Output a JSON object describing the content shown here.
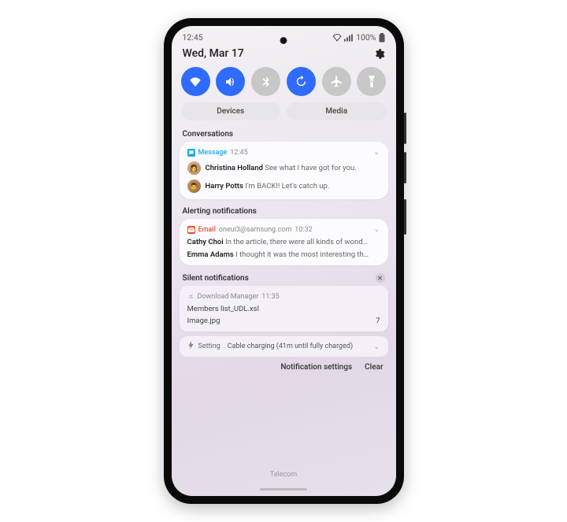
{
  "status": {
    "time": "12:45",
    "battery": "100%"
  },
  "header": {
    "date": "Wed, Mar 17"
  },
  "pills": {
    "devices": "Devices",
    "media": "Media"
  },
  "sections": {
    "conversations": "Conversations",
    "alerting": "Alerting notifications",
    "silent": "Silent notifications"
  },
  "convo": {
    "app": "Message",
    "time": "12:45",
    "items": [
      {
        "sender": "Christina Holland",
        "preview": "See what I have got for you."
      },
      {
        "sender": "Harry Potts",
        "preview": "I'm BACK!! Let's catch up."
      }
    ]
  },
  "email": {
    "app": "Email",
    "addr": "oneui3@samsung.com",
    "time": "10:32",
    "items": [
      {
        "sender": "Cathy Choi",
        "preview": "In the article, there were all kinds of wond…"
      },
      {
        "sender": "Emma Adams",
        "preview": "I thought it was the most interesting th…"
      }
    ]
  },
  "download": {
    "app": "Download Manager",
    "time": "11:35",
    "files": [
      {
        "name": "Members list_UDL.xsl",
        "count": ""
      },
      {
        "name": "Image.jpg",
        "count": "7"
      }
    ]
  },
  "charging": {
    "app": "Setting",
    "text": "Cable charging (41m until fully charged)"
  },
  "footer": {
    "settings": "Notification settings",
    "clear": "Clear"
  },
  "carrier": "Telecom"
}
